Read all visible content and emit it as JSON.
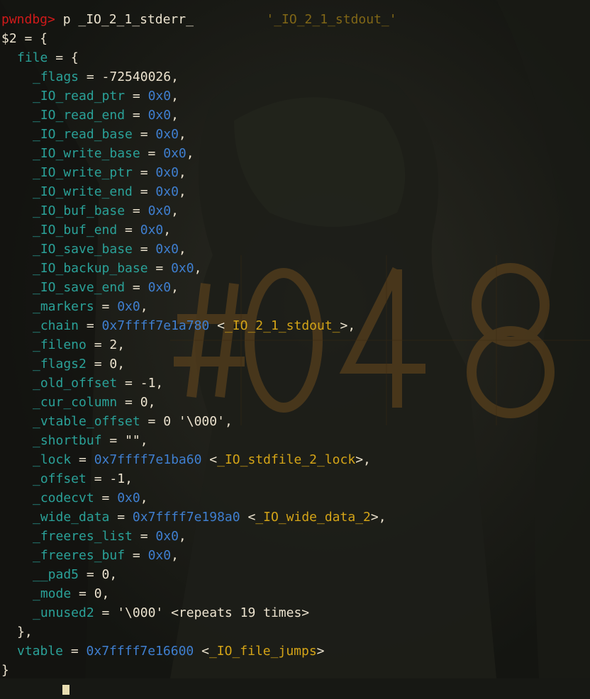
{
  "colors": {
    "background": "#171814",
    "prompt": "#d11a1a",
    "field_name": "#2aa198",
    "hex_value": "#3f7fd0",
    "symbol": "#d4a417",
    "text": "#ece3cf"
  },
  "top_partial_line": "'_IO_2_1_stdout_'",
  "command": {
    "prompt": "pwndbg>",
    "input": " p _IO_2_1_stderr_"
  },
  "result": {
    "header": "$2 = {",
    "file_open": "file = {",
    "fields": [
      {
        "name": "_flags",
        "value": "-72540026",
        "kind": "num",
        "sep": ","
      },
      {
        "name": "_IO_read_ptr",
        "value": "0x0",
        "kind": "hex",
        "sep": ","
      },
      {
        "name": "_IO_read_end",
        "value": "0x0",
        "kind": "hex",
        "sep": ","
      },
      {
        "name": "_IO_read_base",
        "value": "0x0",
        "kind": "hex",
        "sep": ","
      },
      {
        "name": "_IO_write_base",
        "value": "0x0",
        "kind": "hex",
        "sep": ","
      },
      {
        "name": "_IO_write_ptr",
        "value": "0x0",
        "kind": "hex",
        "sep": ","
      },
      {
        "name": "_IO_write_end",
        "value": "0x0",
        "kind": "hex",
        "sep": ","
      },
      {
        "name": "_IO_buf_base",
        "value": "0x0",
        "kind": "hex",
        "sep": ","
      },
      {
        "name": "_IO_buf_end",
        "value": "0x0",
        "kind": "hex",
        "sep": ","
      },
      {
        "name": "_IO_save_base",
        "value": "0x0",
        "kind": "hex",
        "sep": ","
      },
      {
        "name": "_IO_backup_base",
        "value": "0x0",
        "kind": "hex",
        "sep": ","
      },
      {
        "name": "_IO_save_end",
        "value": "0x0",
        "kind": "hex",
        "sep": ","
      },
      {
        "name": "_markers",
        "value": "0x0",
        "kind": "hex",
        "sep": ","
      },
      {
        "name": "_chain",
        "value": "0x7ffff7e1a780",
        "kind": "hex",
        "symbol": "_IO_2_1_stdout_",
        "sep": ","
      },
      {
        "name": "_fileno",
        "value": "2",
        "kind": "num",
        "sep": ","
      },
      {
        "name": "_flags2",
        "value": "0",
        "kind": "num",
        "sep": ","
      },
      {
        "name": "_old_offset",
        "value": "-1",
        "kind": "num",
        "sep": ","
      },
      {
        "name": "_cur_column",
        "value": "0",
        "kind": "num",
        "sep": ","
      },
      {
        "name": "_vtable_offset",
        "value": "0 '\\000'",
        "kind": "num",
        "sep": ","
      },
      {
        "name": "_shortbuf",
        "value": "\"\"",
        "kind": "num",
        "sep": ","
      },
      {
        "name": "_lock",
        "value": "0x7ffff7e1ba60",
        "kind": "hex",
        "symbol": "_IO_stdfile_2_lock",
        "sep": ","
      },
      {
        "name": "_offset",
        "value": "-1",
        "kind": "num",
        "sep": ","
      },
      {
        "name": "_codecvt",
        "value": "0x0",
        "kind": "hex",
        "sep": ","
      },
      {
        "name": "_wide_data",
        "value": "0x7ffff7e198a0",
        "kind": "hex",
        "symbol": "_IO_wide_data_2",
        "sep": ","
      },
      {
        "name": "_freeres_list",
        "value": "0x0",
        "kind": "hex",
        "sep": ","
      },
      {
        "name": "_freeres_buf",
        "value": "0x0",
        "kind": "hex",
        "sep": ","
      },
      {
        "name": "__pad5",
        "value": "0",
        "kind": "num",
        "sep": ","
      },
      {
        "name": "_mode",
        "value": "0",
        "kind": "num",
        "sep": ","
      },
      {
        "name": "_unused2",
        "value": "'\\000' <repeats 19 times>",
        "kind": "num",
        "sep": ""
      }
    ],
    "file_close": "},",
    "vtable": {
      "name": "vtable",
      "value": "0x7ffff7e16600",
      "symbol": "_IO_file_jumps"
    },
    "footer": "}"
  },
  "wallpaper_digits": "#048"
}
